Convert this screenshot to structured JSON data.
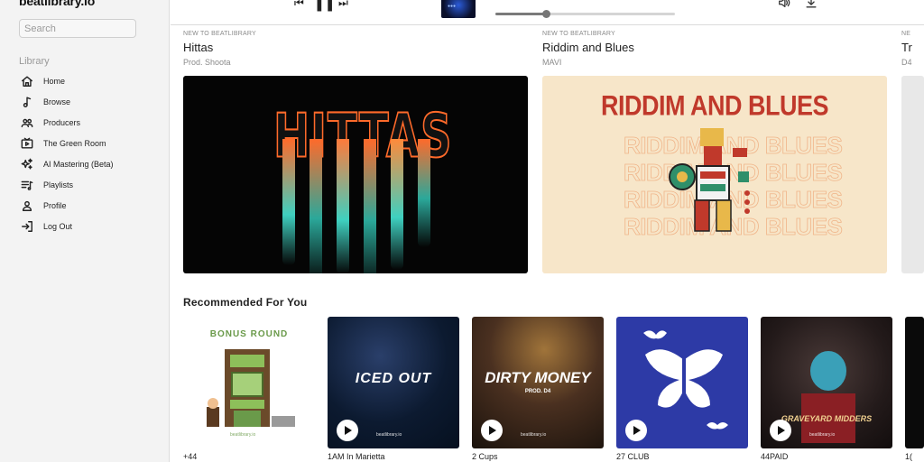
{
  "app": {
    "logo": "beatlibrary.io"
  },
  "sidebar": {
    "search_placeholder": "Search",
    "section_label": "Library",
    "items": [
      {
        "label": "Home",
        "icon": "home-icon"
      },
      {
        "label": "Browse",
        "icon": "music-note-icon"
      },
      {
        "label": "Producers",
        "icon": "users-icon"
      },
      {
        "label": "The Green Room",
        "icon": "tv-play-icon"
      },
      {
        "label": "AI Mastering (Beta)",
        "icon": "sparkles-icon"
      },
      {
        "label": "Playlists",
        "icon": "playlist-icon"
      },
      {
        "label": "Profile",
        "icon": "user-icon"
      },
      {
        "label": "Log Out",
        "icon": "logout-icon"
      }
    ]
  },
  "player": {
    "progress_fraction": 0.28
  },
  "featured": [
    {
      "kicker": "NEW TO BEATLIBRARY",
      "title": "Hittas",
      "subtitle": "Prod. Shoota",
      "art_text": "HITTAS"
    },
    {
      "kicker": "NEW TO BEATLIBRARY",
      "title": "Riddim and Blues",
      "subtitle": "MAVI",
      "art_text": "RIDDIM AND BLUES"
    },
    {
      "kicker": "NE",
      "title": "Tr",
      "subtitle": "D4",
      "art_text": ""
    }
  ],
  "recommended": {
    "heading": "Recommended For You",
    "watermark": "beatlibrary.io",
    "cards": [
      {
        "caption": "+44",
        "cover_text": "BONUS ROUND"
      },
      {
        "caption": "1AM In Marietta",
        "cover_text": "ICED OUT"
      },
      {
        "caption": "2 Cups",
        "cover_text": "DIRTY MONEY",
        "cover_sub": "PROD. D4"
      },
      {
        "caption": "27 CLUB",
        "cover_text": ""
      },
      {
        "caption": "44PAID",
        "cover_text": "GRAVEYARD MIDDERS"
      },
      {
        "caption": "1(",
        "cover_text": ""
      }
    ]
  },
  "colors": {
    "accent_red": "#c0392b",
    "sidebar_bg": "#f3f3f3"
  }
}
